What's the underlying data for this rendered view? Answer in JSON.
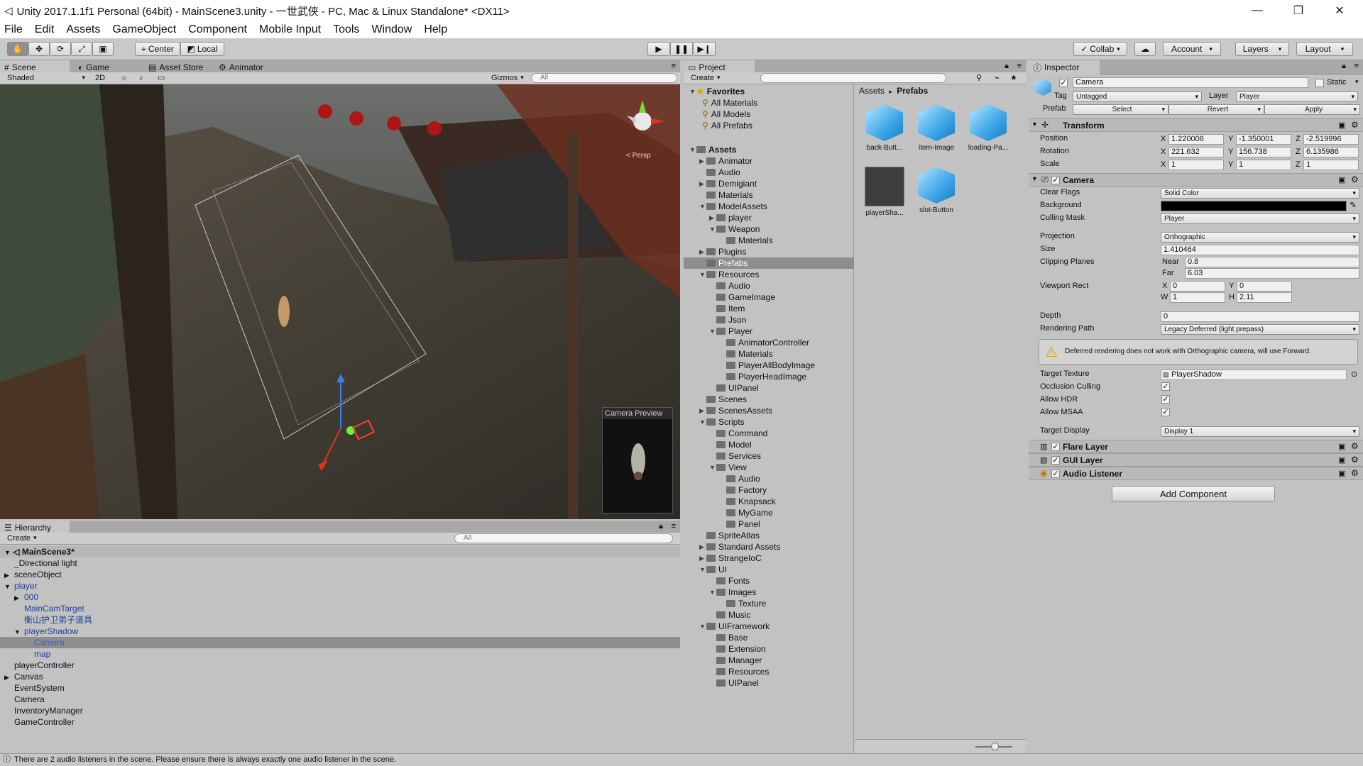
{
  "window": {
    "title": "Unity 2017.1.1f1 Personal (64bit) - MainScene3.unity - 一世武侠 - PC, Mac & Linux Standalone* <DX11>",
    "minimize": "—",
    "restore": "❐",
    "close": "✕"
  },
  "menu": [
    "File",
    "Edit",
    "Assets",
    "GameObject",
    "Component",
    "Mobile Input",
    "Tools",
    "Window",
    "Help"
  ],
  "toolbar": {
    "pivot": "Center",
    "space": "Local",
    "collab": "Collab",
    "account": "Account",
    "layers": "Layers",
    "layout": "Layout"
  },
  "scene": {
    "tabs": [
      "Scene",
      "Game",
      "Asset Store",
      "Animator"
    ],
    "shading": "Shaded",
    "mode2d": "2D",
    "gizmos": "Gizmos",
    "search_placeholder": "All",
    "persp": "< Persp",
    "camera_preview": "Camera Preview"
  },
  "hierarchy": {
    "tab": "Hierarchy",
    "create": "Create",
    "search_placeholder": "All",
    "scene_name": "MainScene3*",
    "rows": [
      {
        "label": "_Directional light",
        "indent": 1,
        "arrow": "",
        "color": "normal"
      },
      {
        "label": "sceneObject",
        "indent": 1,
        "arrow": "▶",
        "color": "normal"
      },
      {
        "label": "player",
        "indent": 1,
        "arrow": "▼",
        "color": "blue"
      },
      {
        "label": "000",
        "indent": 2,
        "arrow": "▶",
        "color": "blue"
      },
      {
        "label": "MainCamTarget",
        "indent": 2,
        "arrow": "",
        "color": "blue"
      },
      {
        "label": "衡山护卫弟子道具",
        "indent": 2,
        "arrow": "",
        "color": "blue"
      },
      {
        "label": "playerShadow",
        "indent": 2,
        "arrow": "▼",
        "color": "blue"
      },
      {
        "label": "Camera",
        "indent": 3,
        "arrow": "",
        "color": "blue",
        "selected": true
      },
      {
        "label": "map",
        "indent": 3,
        "arrow": "",
        "color": "blue"
      },
      {
        "label": "playerController",
        "indent": 1,
        "arrow": "",
        "color": "normal"
      },
      {
        "label": "Canvas",
        "indent": 1,
        "arrow": "▶",
        "color": "normal"
      },
      {
        "label": "EventSystem",
        "indent": 1,
        "arrow": "",
        "color": "normal"
      },
      {
        "label": "Camera",
        "indent": 1,
        "arrow": "",
        "color": "normal"
      },
      {
        "label": "InventoryManager",
        "indent": 1,
        "arrow": "",
        "color": "normal"
      },
      {
        "label": "GameController",
        "indent": 1,
        "arrow": "",
        "color": "normal"
      }
    ]
  },
  "project": {
    "tab": "Project",
    "create": "Create",
    "breadcrumb": [
      "Assets",
      "Prefabs"
    ],
    "favorites_label": "Favorites",
    "favorites": [
      "All Materials",
      "All Models",
      "All Prefabs"
    ],
    "tree": [
      {
        "label": "Assets",
        "indent": 0,
        "arrow": "▼",
        "bold": true
      },
      {
        "label": "Animator",
        "indent": 1,
        "arrow": "▶"
      },
      {
        "label": "Audio",
        "indent": 1,
        "arrow": ""
      },
      {
        "label": "Demigiant",
        "indent": 1,
        "arrow": "▶"
      },
      {
        "label": "Materials",
        "indent": 1,
        "arrow": ""
      },
      {
        "label": "ModelAssets",
        "indent": 1,
        "arrow": "▼"
      },
      {
        "label": "player",
        "indent": 2,
        "arrow": "▶"
      },
      {
        "label": "Weapon",
        "indent": 2,
        "arrow": "▼"
      },
      {
        "label": "Materials",
        "indent": 3,
        "arrow": ""
      },
      {
        "label": "Plugins",
        "indent": 1,
        "arrow": "▶"
      },
      {
        "label": "Prefabs",
        "indent": 1,
        "arrow": "",
        "selected": true
      },
      {
        "label": "Resources",
        "indent": 1,
        "arrow": "▼"
      },
      {
        "label": "Audio",
        "indent": 2,
        "arrow": ""
      },
      {
        "label": "GameImage",
        "indent": 2,
        "arrow": ""
      },
      {
        "label": "Item",
        "indent": 2,
        "arrow": ""
      },
      {
        "label": "Json",
        "indent": 2,
        "arrow": ""
      },
      {
        "label": "Player",
        "indent": 2,
        "arrow": "▼"
      },
      {
        "label": "AnimatorController",
        "indent": 3,
        "arrow": ""
      },
      {
        "label": "Materials",
        "indent": 3,
        "arrow": ""
      },
      {
        "label": "PlayerAllBodyImage",
        "indent": 3,
        "arrow": ""
      },
      {
        "label": "PlayerHeadImage",
        "indent": 3,
        "arrow": ""
      },
      {
        "label": "UIPanel",
        "indent": 2,
        "arrow": ""
      },
      {
        "label": "Scenes",
        "indent": 1,
        "arrow": ""
      },
      {
        "label": "ScenesAssets",
        "indent": 1,
        "arrow": "▶"
      },
      {
        "label": "Scripts",
        "indent": 1,
        "arrow": "▼"
      },
      {
        "label": "Command",
        "indent": 2,
        "arrow": ""
      },
      {
        "label": "Model",
        "indent": 2,
        "arrow": ""
      },
      {
        "label": "Services",
        "indent": 2,
        "arrow": ""
      },
      {
        "label": "View",
        "indent": 2,
        "arrow": "▼"
      },
      {
        "label": "Audio",
        "indent": 3,
        "arrow": ""
      },
      {
        "label": "Factory",
        "indent": 3,
        "arrow": ""
      },
      {
        "label": "Knapsack",
        "indent": 3,
        "arrow": ""
      },
      {
        "label": "MyGame",
        "indent": 3,
        "arrow": ""
      },
      {
        "label": "Panel",
        "indent": 3,
        "arrow": ""
      },
      {
        "label": "SpriteAtlas",
        "indent": 1,
        "arrow": ""
      },
      {
        "label": "Standard Assets",
        "indent": 1,
        "arrow": "▶"
      },
      {
        "label": "StrangeIoC",
        "indent": 1,
        "arrow": "▶"
      },
      {
        "label": "UI",
        "indent": 1,
        "arrow": "▼"
      },
      {
        "label": "Fonts",
        "indent": 2,
        "arrow": ""
      },
      {
        "label": "Images",
        "indent": 2,
        "arrow": "▼"
      },
      {
        "label": "Texture",
        "indent": 3,
        "arrow": ""
      },
      {
        "label": "Music",
        "indent": 2,
        "arrow": ""
      },
      {
        "label": "UIFramework",
        "indent": 1,
        "arrow": "▼"
      },
      {
        "label": "Base",
        "indent": 2,
        "arrow": ""
      },
      {
        "label": "Extension",
        "indent": 2,
        "arrow": ""
      },
      {
        "label": "Manager",
        "indent": 2,
        "arrow": ""
      },
      {
        "label": "Resources",
        "indent": 2,
        "arrow": ""
      },
      {
        "label": "UIPanel",
        "indent": 2,
        "arrow": ""
      }
    ],
    "assets": [
      {
        "label": "back-Butt...",
        "kind": "cube"
      },
      {
        "label": "item-Image",
        "kind": "cube"
      },
      {
        "label": "loading-Pa...",
        "kind": "cube"
      },
      {
        "label": "playerSha...",
        "kind": "dark"
      },
      {
        "label": "slot-Button",
        "kind": "cube"
      }
    ]
  },
  "inspector": {
    "tab": "Inspector",
    "object_name": "Camera",
    "static": "Static",
    "tag_label": "Tag",
    "tag_value": "Untagged",
    "layer_label": "Layer",
    "layer_value": "Player",
    "prefab_label": "Prefab",
    "prefab_select": "Select",
    "prefab_revert": "Revert",
    "prefab_apply": "Apply",
    "transform": {
      "title": "Transform",
      "position_label": "Position",
      "rotation_label": "Rotation",
      "scale_label": "Scale",
      "position": [
        "1.220006",
        "-1.350001",
        "-2.519996"
      ],
      "rotation": [
        "221.632",
        "156.738",
        "6.135986"
      ],
      "scale": [
        "1",
        "1",
        "1"
      ]
    },
    "camera": {
      "title": "Camera",
      "clear_flags_label": "Clear Flags",
      "clear_flags": "Solid Color",
      "background_label": "Background",
      "background_color": "#000000",
      "culling_mask_label": "Culling Mask",
      "culling_mask": "Player",
      "projection_label": "Projection",
      "projection": "Orthographic",
      "size_label": "Size",
      "size": "1.410464",
      "clipping_label": "Clipping Planes",
      "near_label": "Near",
      "near": "0.8",
      "far_label": "Far",
      "far": "6.03",
      "viewport_label": "Viewport Rect",
      "vx": "0",
      "vy": "0",
      "vw": "1",
      "vh": "2.11",
      "depth_label": "Depth",
      "depth": "0",
      "rendering_path_label": "Rendering Path",
      "rendering_path": "Legacy Deferred (light prepass)",
      "warning": "Deferred rendering does not work with Orthographic camera, will use Forward.",
      "target_texture_label": "Target Texture",
      "target_texture": "PlayerShadow",
      "occlusion_label": "Occlusion Culling",
      "hdr_label": "Allow HDR",
      "msaa_label": "Allow MSAA",
      "target_display_label": "Target Display",
      "target_display": "Display 1"
    },
    "components": [
      "Flare Layer",
      "GUI Layer",
      "Audio Listener"
    ],
    "add_component": "Add Component"
  },
  "status": "There are 2 audio listeners in the scene. Please ensure there is always exactly one audio listener in the scene."
}
